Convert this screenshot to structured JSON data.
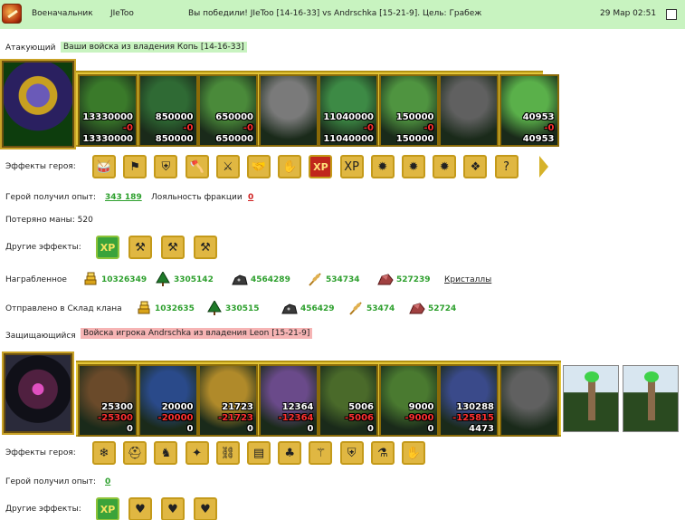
{
  "header": {
    "rank": "Военачальник",
    "player": "JIeToo",
    "message": "Вы победили! JIeToo [14-16-33] vs Andrschka [15-21-9]. Цель: Грабеж",
    "datetime": "29 Мар 02:51"
  },
  "attacker": {
    "label": "Атакующий",
    "title": "Ваши войска из владения Копь [14-16-33]",
    "units": [
      {
        "name": "unit-green-armored-rider",
        "a": "13330000",
        "b": "-0",
        "c": "13330000",
        "color": "#3a7a2a"
      },
      {
        "name": "unit-green-knight",
        "a": "850000",
        "b": "-0",
        "c": "850000",
        "color": "#2f6a34"
      },
      {
        "name": "unit-green-spearman",
        "a": "650000",
        "b": "-0",
        "c": "650000",
        "color": "#4a8a3a"
      },
      {
        "name": "unit-grey-griffin",
        "a": "",
        "b": "",
        "c": "",
        "color": "#7a7a7a"
      },
      {
        "name": "unit-green-archer",
        "a": "11040000",
        "b": "-0",
        "c": "11040000",
        "color": "#3d8a45"
      },
      {
        "name": "unit-green-lancer",
        "a": "150000",
        "b": "-0",
        "c": "150000",
        "color": "#4f9440"
      },
      {
        "name": "unit-grey-ghost",
        "a": "",
        "b": "",
        "c": "",
        "color": "#606060"
      },
      {
        "name": "unit-green-druid",
        "a": "40953",
        "b": "-0",
        "c": "40953",
        "color": "#5ab04a"
      }
    ],
    "effects_label": "Эффекты героя:",
    "effects": [
      "war-drum-icon",
      "red-flag-icon",
      "shield-icon",
      "axe-icon",
      "sword-icon",
      "handshake-icon",
      "grasp-icon",
      "xp-red-icon",
      "xp-dark-icon",
      "sun-icon",
      "sun-icon",
      "sun-icon",
      "dragon-icon",
      "question-icon"
    ],
    "xp_label": "Герой получил опыт:",
    "xp_value": "343 189",
    "loyalty_label": "Лояльность фракции",
    "loyalty_value": "0",
    "mana_label": "Потеряно маны: 520",
    "other_label": "Другие эффекты:",
    "other_effects": [
      "xp-green-icon",
      "axe-attack-icon",
      "axe-attack-icon",
      "axe-attack-icon"
    ],
    "loot_label": "Награбленное",
    "loot": [
      {
        "icon": "gold-icon",
        "value": "10326349"
      },
      {
        "icon": "wood-icon",
        "value": "3305142"
      },
      {
        "icon": "ore-icon",
        "value": "4564289"
      },
      {
        "icon": "grain-icon",
        "value": "534734"
      },
      {
        "icon": "crystal-icon",
        "value": "527239"
      }
    ],
    "crystals_link": "Кристаллы",
    "stash_label": "Отправлено в Склад клана",
    "stash": [
      {
        "icon": "gold-icon",
        "value": "1032635"
      },
      {
        "icon": "wood-icon",
        "value": "330515"
      },
      {
        "icon": "ore-icon",
        "value": "456429"
      },
      {
        "icon": "grain-icon",
        "value": "53474"
      },
      {
        "icon": "crystal-icon",
        "value": "52724"
      }
    ]
  },
  "defender": {
    "label": "Защищающийся",
    "title": "Войска игрока Andrschka из владения Leon [15-21-9]",
    "units": [
      {
        "name": "unit-crowned-king",
        "a": "25300",
        "b": "-25300",
        "c": "0",
        "color": "#6a4a2a"
      },
      {
        "name": "unit-blue-paladin",
        "a": "20000",
        "b": "-20000",
        "c": "0",
        "color": "#2a4a8a"
      },
      {
        "name": "unit-golden-knight",
        "a": "21723",
        "b": "-21723",
        "c": "0",
        "color": "#b08a2a"
      },
      {
        "name": "unit-golden-dragon",
        "a": "12364",
        "b": "-12364",
        "c": "0",
        "color": "#6a4a8a"
      },
      {
        "name": "unit-archer-bow",
        "a": "5006",
        "b": "-5006",
        "c": "0",
        "color": "#4a6a2a"
      },
      {
        "name": "unit-green-swordsman",
        "a": "9000",
        "b": "-9000",
        "c": "0",
        "color": "#4a7a30"
      },
      {
        "name": "unit-angel-warrior",
        "a": "130288",
        "b": "-125815",
        "c": "4473",
        "color": "#3a4a8a"
      },
      {
        "name": "unit-grey-specter",
        "a": "",
        "b": "",
        "c": "",
        "color": "#606060"
      }
    ],
    "effects_label": "Эффекты героя:",
    "effects": [
      "frost-icon",
      "helmet-icon",
      "armored-knight-icon",
      "beam-icon",
      "chains-icon",
      "book-icon",
      "clover-icon",
      "staff-icon",
      "golden-shield-icon",
      "potion-icon",
      "claw-icon"
    ],
    "xp_label": "Герой получил опыт:",
    "xp_value": "0",
    "other_label": "Другие эффекты:",
    "other_effects": [
      "xp-green-icon",
      "heart-shield-icon",
      "heart-shield-icon",
      "heart-shield-icon"
    ]
  }
}
